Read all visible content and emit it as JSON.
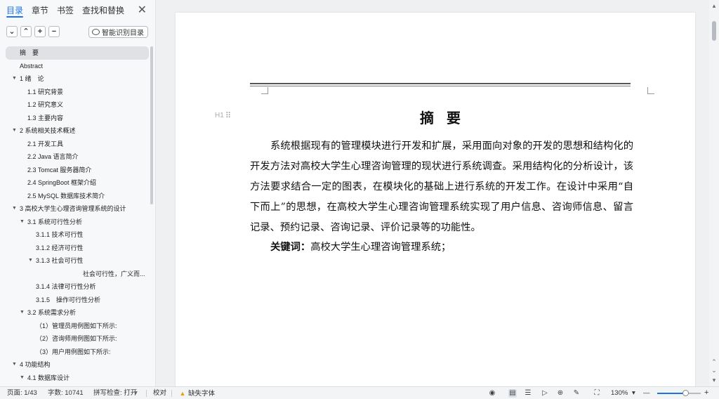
{
  "tabs": [
    {
      "label": "目录",
      "active": true
    },
    {
      "label": "章节",
      "active": false
    },
    {
      "label": "书签",
      "active": false
    },
    {
      "label": "查找和替换",
      "active": false
    }
  ],
  "panel_close": "✕",
  "toolbar": {
    "collapse": "⌄",
    "expand": "⌃",
    "add": "+",
    "remove": "−",
    "smart_label": "智能识别目录"
  },
  "toc": [
    {
      "label": "摘　要",
      "level": 0,
      "selected": true
    },
    {
      "label": "Abstract",
      "level": 0
    },
    {
      "label": "1  绪　论",
      "level": 0,
      "arrow": true
    },
    {
      "label": "1.1  研究背景",
      "level": 1
    },
    {
      "label": "1.2  研究意义",
      "level": 1
    },
    {
      "label": "1.3  主要内容",
      "level": 1
    },
    {
      "label": "2 系统相关技术概述",
      "level": 0,
      "arrow": true
    },
    {
      "label": "2.1 开发工具",
      "level": 1
    },
    {
      "label": "2.2 Java 语言简介",
      "level": 1
    },
    {
      "label": "2.3 Tomcat 服务器简介",
      "level": 1
    },
    {
      "label": "2.4 SpringBoot 框架介绍",
      "level": 1
    },
    {
      "label": "2.5 MySQL 数据库技术简介",
      "level": 1
    },
    {
      "label": "3  高校大学生心理咨询管理系统的设计",
      "level": 0,
      "arrow": true
    },
    {
      "label": "3.1 系统可行性分析",
      "level": 1,
      "arrow": true
    },
    {
      "label": "3.1.1 技术可行性",
      "level": 2
    },
    {
      "label": "3.1.2 经济可行性",
      "level": 2
    },
    {
      "label": "3.1.3 社会可行性",
      "level": 2,
      "arrow": true
    },
    {
      "label": "社会可行性，广义而...",
      "level": 3
    },
    {
      "label": "3.1.4 法律可行性分析",
      "level": 2
    },
    {
      "label": "3.1.5　操作可行性分析",
      "level": 2
    },
    {
      "label": "3.2  系统需求分析",
      "level": 1,
      "arrow": true
    },
    {
      "label": "（1）管理员用例图如下所示:",
      "level": 2
    },
    {
      "label": "（2）咨询师用例图如下所示:",
      "level": 2
    },
    {
      "label": "（3）用户用例图如下所示:",
      "level": 2
    },
    {
      "label": "4 功能结构",
      "level": 0,
      "arrow": true
    },
    {
      "label": "4.1  数据库设计",
      "level": 1,
      "arrow": true
    }
  ],
  "document": {
    "heading_marker": "H1",
    "title": "摘要",
    "body": "系统根据现有的管理模块进行开发和扩展，采用面向对象的开发的思想和结构化的开发方法对高校大学生心理咨询管理的现状进行系统调查。采用结构化的分析设计，该方法要求结合一定的图表，在模块化的基础上进行系统的开发工作。在设计中采用“自下而上”的思想，在高校大学生心理咨询管理系统实现了用户信息、咨询师信息、留言记录、预约记录、咨询记录、评价记录等的功能性。",
    "keywords_label": "关键词：",
    "keywords": "高校大学生心理咨询管理系统；"
  },
  "status": {
    "page": "页面: 1/43",
    "words": "字数: 10741",
    "spellcheck": "拼写检查: 打开",
    "proofread": "校对",
    "missing_font": "缺失字体",
    "zoom": "130%",
    "zoom_minus": "—",
    "zoom_plus": "+"
  }
}
